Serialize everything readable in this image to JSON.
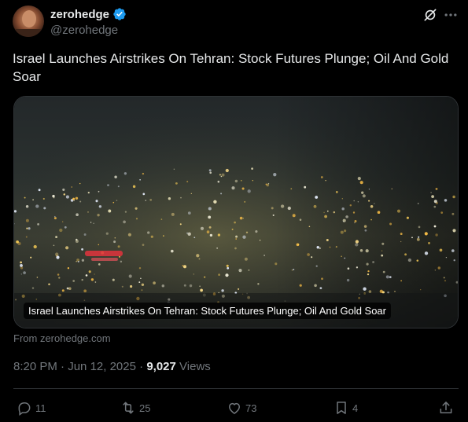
{
  "author": {
    "display_name": "zerohedge",
    "handle": "@zerohedge",
    "verified_color": "#1d9bf0"
  },
  "icons": {
    "verified": "verified-badge-icon",
    "grok": "grok-icon",
    "more": "more-dots-icon",
    "reply": "reply-icon",
    "retweet": "retweet-icon",
    "like": "like-icon",
    "bookmark": "bookmark-icon",
    "share": "share-icon"
  },
  "tweet": {
    "text": "Israel Launches Airstrikes On Tehran: Stock Futures Plunge; Oil And Gold Soar"
  },
  "media": {
    "caption": "Israel Launches Airstrikes On Tehran: Stock Futures Plunge; Oil And Gold Soar",
    "source": "From zerohedge.com"
  },
  "meta": {
    "time": "8:20 PM",
    "separator": "·",
    "date": "Jun 12, 2025",
    "views_count": "9,027",
    "views_label": "Views"
  },
  "actions": {
    "replies": "11",
    "retweets": "25",
    "likes": "73",
    "bookmarks": "4"
  },
  "colors": {
    "background": "#000000",
    "text": "#e7e9ea",
    "secondary": "#71767b",
    "border": "#2f3336"
  }
}
